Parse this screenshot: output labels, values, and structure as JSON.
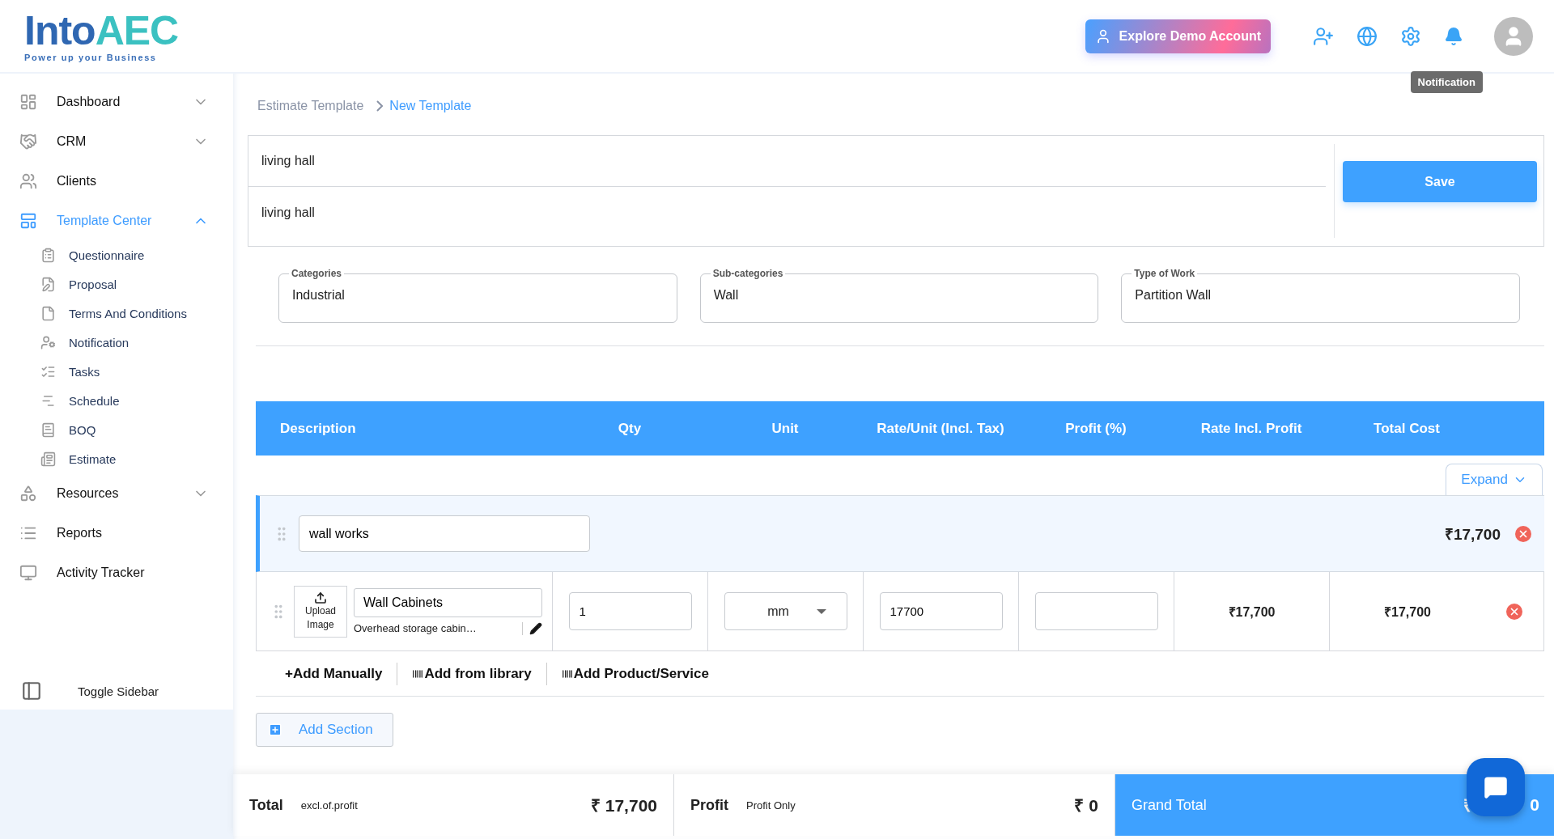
{
  "logo": {
    "primary": "Into",
    "accent": "AEC",
    "tagline": "Power up your Business"
  },
  "header": {
    "demo_button": "Explore Demo Account",
    "tooltip": "Notification"
  },
  "sidebar": {
    "items": [
      {
        "label": "Dashboard",
        "kind": "group",
        "expanded": false,
        "selected": false
      },
      {
        "label": "CRM",
        "kind": "group",
        "expanded": false,
        "selected": false
      },
      {
        "label": "Clients",
        "kind": "link",
        "selected": false
      },
      {
        "label": "Template Center",
        "kind": "group",
        "expanded": true,
        "selected": true,
        "children": [
          {
            "label": "Questionnaire",
            "selected": false
          },
          {
            "label": "Proposal",
            "selected": false
          },
          {
            "label": "Terms And Conditions",
            "selected": false
          },
          {
            "label": "Notification",
            "selected": false
          },
          {
            "label": "Tasks",
            "selected": false
          },
          {
            "label": "Schedule",
            "selected": false
          },
          {
            "label": "BOQ",
            "selected": false
          },
          {
            "label": "Estimate",
            "selected": false
          }
        ]
      },
      {
        "label": "Resources",
        "kind": "group",
        "expanded": false,
        "selected": false
      },
      {
        "label": "Reports",
        "kind": "link",
        "selected": false
      },
      {
        "label": "Activity Tracker",
        "kind": "link",
        "selected": false
      }
    ],
    "toggle": "Toggle Sidebar"
  },
  "breadcrumb": [
    {
      "label": "Estimate Template",
      "selected": false
    },
    {
      "label": "New Template",
      "selected": true
    }
  ],
  "template": {
    "name": "living hall",
    "description": "living hall",
    "save": "Save"
  },
  "fields": [
    {
      "label": "Categories",
      "value": "Industrial"
    },
    {
      "label": "Sub-categories",
      "value": "Wall"
    },
    {
      "label": "Type of Work",
      "value": "Partition Wall"
    }
  ],
  "table": {
    "columns": [
      "Description",
      "Qty",
      "Unit",
      "Rate/Unit (Incl. Tax)",
      "Profit (%)",
      "Rate Incl. Profit",
      "Total Cost"
    ],
    "expand": "Expand",
    "section": {
      "name": "wall works",
      "total": "₹17,700"
    },
    "rows": [
      {
        "upload": "Upload Image",
        "name": "Wall Cabinets",
        "description": "Overhead storage cabin…",
        "qty": "1",
        "unit": "mm",
        "rate": "17700",
        "rate_incl_profit": "₹17,700",
        "total_cost": "₹17,700"
      }
    ],
    "actions": [
      "+Add Manually",
      "Add from library",
      "Add Product/Service"
    ],
    "add_section": "Add Section"
  },
  "footer": {
    "total": {
      "label": "Total",
      "note": "excl.of.profit",
      "value": "₹ 17,700"
    },
    "profit": {
      "label": "Profit",
      "note": "Profit Only",
      "value": "₹ 0"
    },
    "grand_total": {
      "label": "Grand Total",
      "currency": "₹",
      "value_tail": "0"
    }
  }
}
